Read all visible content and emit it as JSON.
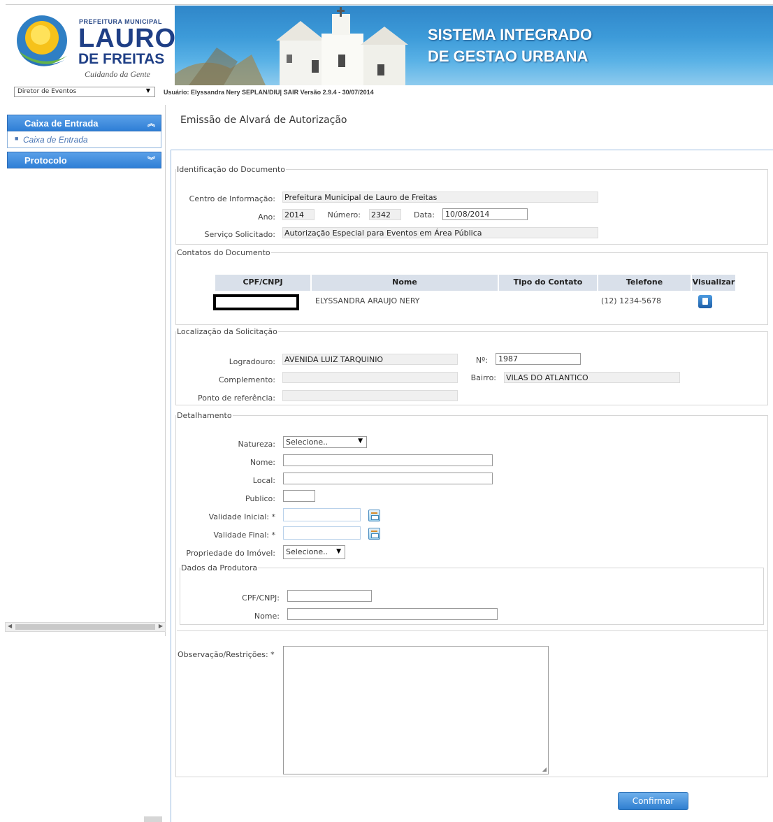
{
  "header": {
    "logo": {
      "prefeitura": "PREFEITURA MUNICIPAL",
      "name_line1": "LAURO",
      "name_line2": "DE FREITAS",
      "tagline": "Cuidando da Gente"
    },
    "banner_title_line1": "SISTEMA INTEGRADO",
    "banner_title_line2": "DE GESTAO URBANA",
    "role_select_value": "Diretor de Eventos",
    "user_line": "Usuário: Elyssandra Nery SEPLAN/DIU| SAIR Versão 2.9.4 - 30/07/2014"
  },
  "sidebar": {
    "sections": [
      {
        "label": "Caixa de Entrada",
        "chevron": "up-chevron-icon",
        "items": [
          {
            "label": "Caixa de Entrada"
          }
        ]
      },
      {
        "label": "Protocolo",
        "chevron": "down-chevron-icon",
        "items": []
      }
    ]
  },
  "page": {
    "title": "Emissão de Alvará de Autorização"
  },
  "identificacao": {
    "legend": "Identificação do Documento",
    "centro_label": "Centro de Informação:",
    "centro_value": "Prefeitura Municipal de Lauro de Freitas",
    "ano_label": "Ano:",
    "ano_value": "2014",
    "numero_label": "Número:",
    "numero_value": "2342",
    "data_label": "Data:",
    "data_value": "10/08/2014",
    "servico_label": "Serviço Solicitado:",
    "servico_value": "Autorização Especial para Eventos em Área Pública"
  },
  "contatos": {
    "legend": "Contatos do Documento",
    "columns": [
      "CPF/CNPJ",
      "Nome",
      "Tipo do Contato",
      "Telefone",
      "Visualizar"
    ],
    "rows": [
      {
        "cpf": "",
        "nome": "ELYSSANDRA ARAUJO NERY",
        "tipo": "",
        "telefone": "(12) 1234-5678",
        "view_icon": "document-view-icon"
      }
    ]
  },
  "localizacao": {
    "legend": "Localização da Solicitação",
    "logradouro_label": "Logradouro:",
    "logradouro_value": "AVENIDA LUIZ TARQUINIO",
    "numero_label": "Nº:",
    "numero_value": "1987",
    "complemento_label": "Complemento:",
    "complemento_value": "",
    "bairro_label": "Bairro:",
    "bairro_value": "VILAS DO ATLANTICO",
    "referencia_label": "Ponto de referência:",
    "referencia_value": ""
  },
  "detalhamento": {
    "legend": "Detalhamento",
    "natureza_label": "Natureza:",
    "natureza_value": "Selecione..",
    "nome_label": "Nome:",
    "local_label": "Local:",
    "publico_label": "Publico:",
    "validade_inicial_label": "Validade Inicial: *",
    "validade_final_label": "Validade Final: *",
    "propriedade_label": "Propriedade do Imóvel:",
    "propriedade_value": "Selecione..",
    "produtora": {
      "legend": "Dados da Produtora",
      "cpf_label": "CPF/CNPJ:",
      "nome_label": "Nome:"
    },
    "observacao_label": "Observação/Restrições: *"
  },
  "actions": {
    "confirm_label": "Confirmar"
  },
  "colors": {
    "accent": "#2f7fd6",
    "nav_text": "#4d78b5",
    "table_header": "#d9e0ea"
  }
}
